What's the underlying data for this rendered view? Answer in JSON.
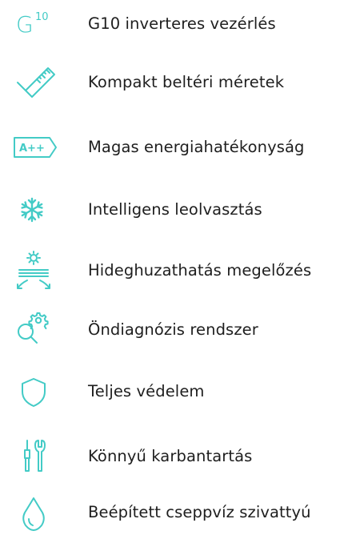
{
  "colors": {
    "accent": "#43cbc6",
    "text": "#1e1e1e",
    "background": "#ffffff"
  },
  "features": [
    {
      "icon": "g10-inverter-icon",
      "icon_text": "G",
      "icon_superscript": "10",
      "label": "G10 inverteres vezérlés"
    },
    {
      "icon": "ruler-check-icon",
      "label": "Kompakt beltéri méretek"
    },
    {
      "icon": "energy-class-icon",
      "icon_text": "A++",
      "label": "Magas energiahatékonyság"
    },
    {
      "icon": "snowflake-icon",
      "label": "Intelligens leolvasztás"
    },
    {
      "icon": "air-deflector-icon",
      "label": "Hideghuzathatás megelőzés"
    },
    {
      "icon": "gear-magnifier-icon",
      "label": "Öndiagnózis rendszer"
    },
    {
      "icon": "shield-icon",
      "label": "Teljes védelem"
    },
    {
      "icon": "tools-icon",
      "label": "Könnyű karbantartás"
    },
    {
      "icon": "water-drop-icon",
      "label": "Beépített cseppvíz szivattyú"
    }
  ]
}
